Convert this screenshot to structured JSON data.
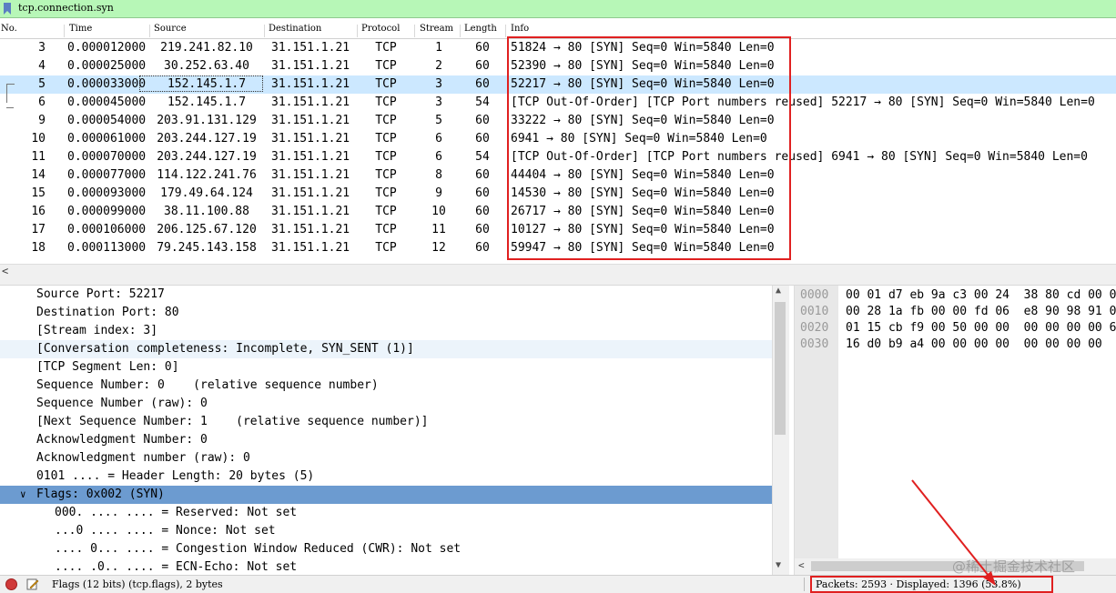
{
  "filter": {
    "text": "tcp.connection.syn"
  },
  "packet_list": {
    "headers": {
      "no": "No.",
      "time": "Time",
      "source": "Source",
      "destination": "Destination",
      "protocol": "Protocol",
      "stream": "Stream",
      "length": "Length",
      "info": "Info"
    },
    "rows": [
      {
        "no": "3",
        "time": "0.000012000",
        "src": "219.241.82.10",
        "dst": "31.151.1.21",
        "proto": "TCP",
        "stream": "1",
        "len": "60",
        "info": "51824 → 80 [SYN] Seq=0 Win=5840 Len=0"
      },
      {
        "no": "4",
        "time": "0.000025000",
        "src": "30.252.63.40",
        "dst": "31.151.1.21",
        "proto": "TCP",
        "stream": "2",
        "len": "60",
        "info": "52390 → 80 [SYN] Seq=0 Win=5840 Len=0"
      },
      {
        "no": "5",
        "time": "0.000033000",
        "src": "152.145.1.7",
        "dst": "31.151.1.21",
        "proto": "TCP",
        "stream": "3",
        "len": "60",
        "info": "52217 → 80 [SYN] Seq=0 Win=5840 Len=0"
      },
      {
        "no": "6",
        "time": "0.000045000",
        "src": "152.145.1.7",
        "dst": "31.151.1.21",
        "proto": "TCP",
        "stream": "3",
        "len": "54",
        "info": "[TCP Out-Of-Order] [TCP Port numbers reused] 52217 → 80 [SYN] Seq=0 Win=5840 Len=0"
      },
      {
        "no": "9",
        "time": "0.000054000",
        "src": "203.91.131.129",
        "dst": "31.151.1.21",
        "proto": "TCP",
        "stream": "5",
        "len": "60",
        "info": "33222 → 80 [SYN] Seq=0 Win=5840 Len=0"
      },
      {
        "no": "10",
        "time": "0.000061000",
        "src": "203.244.127.19",
        "dst": "31.151.1.21",
        "proto": "TCP",
        "stream": "6",
        "len": "60",
        "info": "6941 → 80 [SYN] Seq=0 Win=5840 Len=0"
      },
      {
        "no": "11",
        "time": "0.000070000",
        "src": "203.244.127.19",
        "dst": "31.151.1.21",
        "proto": "TCP",
        "stream": "6",
        "len": "54",
        "info": "[TCP Out-Of-Order] [TCP Port numbers reused] 6941 → 80 [SYN] Seq=0 Win=5840 Len=0"
      },
      {
        "no": "14",
        "time": "0.000077000",
        "src": "114.122.241.76",
        "dst": "31.151.1.21",
        "proto": "TCP",
        "stream": "8",
        "len": "60",
        "info": "44404 → 80 [SYN] Seq=0 Win=5840 Len=0"
      },
      {
        "no": "15",
        "time": "0.000093000",
        "src": "179.49.64.124",
        "dst": "31.151.1.21",
        "proto": "TCP",
        "stream": "9",
        "len": "60",
        "info": "14530 → 80 [SYN] Seq=0 Win=5840 Len=0"
      },
      {
        "no": "16",
        "time": "0.000099000",
        "src": "38.11.100.88",
        "dst": "31.151.1.21",
        "proto": "TCP",
        "stream": "10",
        "len": "60",
        "info": "26717 → 80 [SYN] Seq=0 Win=5840 Len=0"
      },
      {
        "no": "17",
        "time": "0.000106000",
        "src": "206.125.67.120",
        "dst": "31.151.1.21",
        "proto": "TCP",
        "stream": "11",
        "len": "60",
        "info": "10127 → 80 [SYN] Seq=0 Win=5840 Len=0"
      },
      {
        "no": "18",
        "time": "0.000113000",
        "src": "79.245.143.158",
        "dst": "31.151.1.21",
        "proto": "TCP",
        "stream": "12",
        "len": "60",
        "info": "59947 → 80 [SYN] Seq=0 Win=5840 Len=0"
      }
    ],
    "selected_no": "5"
  },
  "details": {
    "lines": [
      "Source Port: 52217",
      "Destination Port: 80",
      "[Stream index: 3]",
      "[Conversation completeness: Incomplete, SYN_SENT (1)]",
      "[TCP Segment Len: 0]",
      "Sequence Number: 0    (relative sequence number)",
      "Sequence Number (raw): 0",
      "[Next Sequence Number: 1    (relative sequence number)]",
      "Acknowledgment Number: 0",
      "Acknowledgment number (raw): 0",
      "0101 .... = Header Length: 20 bytes (5)",
      "Flags: 0x002 (SYN)",
      "000. .... .... = Reserved: Not set",
      "...0 .... .... = Nonce: Not set",
      ".... 0... .... = Congestion Window Reduced (CWR): Not set",
      ".... .0.. .... = ECN-Echo: Not set"
    ]
  },
  "bytes": {
    "rows": [
      {
        "offset": "0000",
        "hex": "00 01 d7 eb 9a c3 00 24  38 80 cd 00 0"
      },
      {
        "offset": "0010",
        "hex": "00 28 1a fb 00 00 fd 06  e8 90 98 91 0"
      },
      {
        "offset": "0020",
        "hex": "01 15 cb f9 00 50 00 00  00 00 00 00 6"
      },
      {
        "offset": "0030",
        "hex": "16 d0 b9 a4 00 00 00 00  00 00 00 00"
      }
    ]
  },
  "status": {
    "field_info": "Flags (12 bits) (tcp.flags), 2 bytes",
    "packets": "Packets: 2593 · Displayed: 1396 (53.8%)"
  },
  "watermark": "@稀土掘金技术社区",
  "colors": {
    "filter_bg": "#b7f7b7",
    "selected_row": "#cce8ff",
    "selected_detail": "#6c9bd0",
    "annotation_red": "#e02020"
  }
}
